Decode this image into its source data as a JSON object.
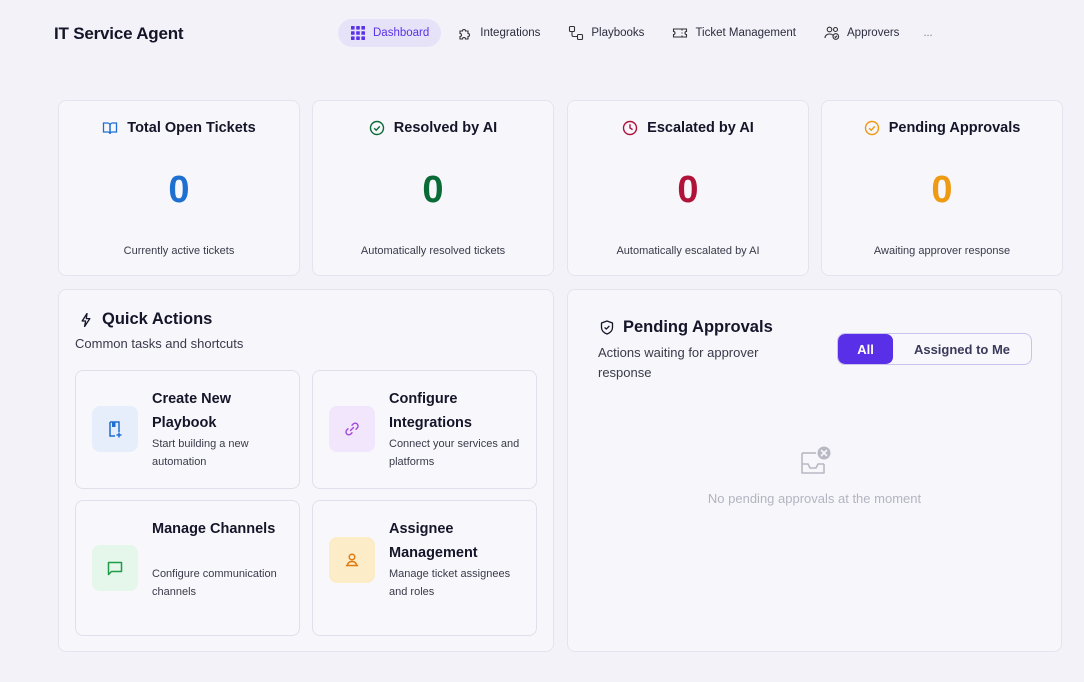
{
  "app": {
    "title": "IT Service Agent"
  },
  "nav": {
    "items": [
      {
        "label": "Dashboard",
        "icon": "grid-icon",
        "active": true
      },
      {
        "label": "Integrations",
        "icon": "puzzle-icon"
      },
      {
        "label": "Playbooks",
        "icon": "workflow-icon"
      },
      {
        "label": "Ticket Management",
        "icon": "ticket-icon"
      },
      {
        "label": "Approvers",
        "icon": "users-check-icon"
      }
    ],
    "more": "..."
  },
  "stats": [
    {
      "title": "Total Open Tickets",
      "value": "0",
      "description": "Currently active tickets",
      "color": "#1f6fd1",
      "icon": "book-open-icon"
    },
    {
      "title": "Resolved by AI",
      "value": "0",
      "description": "Automatically resolved tickets",
      "color": "#0b6b36",
      "icon": "check-circle-icon"
    },
    {
      "title": "Escalated by AI",
      "value": "0",
      "description": "Automatically escalated by AI",
      "color": "#b0123a",
      "icon": "clock-icon"
    },
    {
      "title": "Pending Approvals",
      "value": "0",
      "description": "Awaiting approver response",
      "color": "#ee9a12",
      "icon": "check-circle-icon"
    }
  ],
  "quick_actions": {
    "title": "Quick Actions",
    "subtitle": "Common tasks and shortcuts",
    "items": [
      {
        "title": "Create New Playbook",
        "description": "Start building a new automation",
        "icon": "book-plus-icon"
      },
      {
        "title": "Configure Integrations",
        "description": "Connect your services and platforms",
        "icon": "link-icon"
      },
      {
        "title": "Manage Channels",
        "description": "Configure communication channels",
        "icon": "message-square-icon"
      },
      {
        "title": "Assignee Management",
        "description": "Manage ticket assignees and roles",
        "icon": "user-icon"
      }
    ]
  },
  "pending_approvals": {
    "title": "Pending Approvals",
    "subtitle": "Actions waiting for approver response",
    "filter_all": "All",
    "filter_me": "Assigned to Me",
    "empty_text": "No pending approvals at the moment",
    "empty_icon": "inbox-x-icon"
  },
  "colors": {
    "accent": "#5a2fe8",
    "blue": "#1f6fd1",
    "green": "#0b6b36",
    "red": "#b0123a",
    "orange": "#ee9a12"
  }
}
